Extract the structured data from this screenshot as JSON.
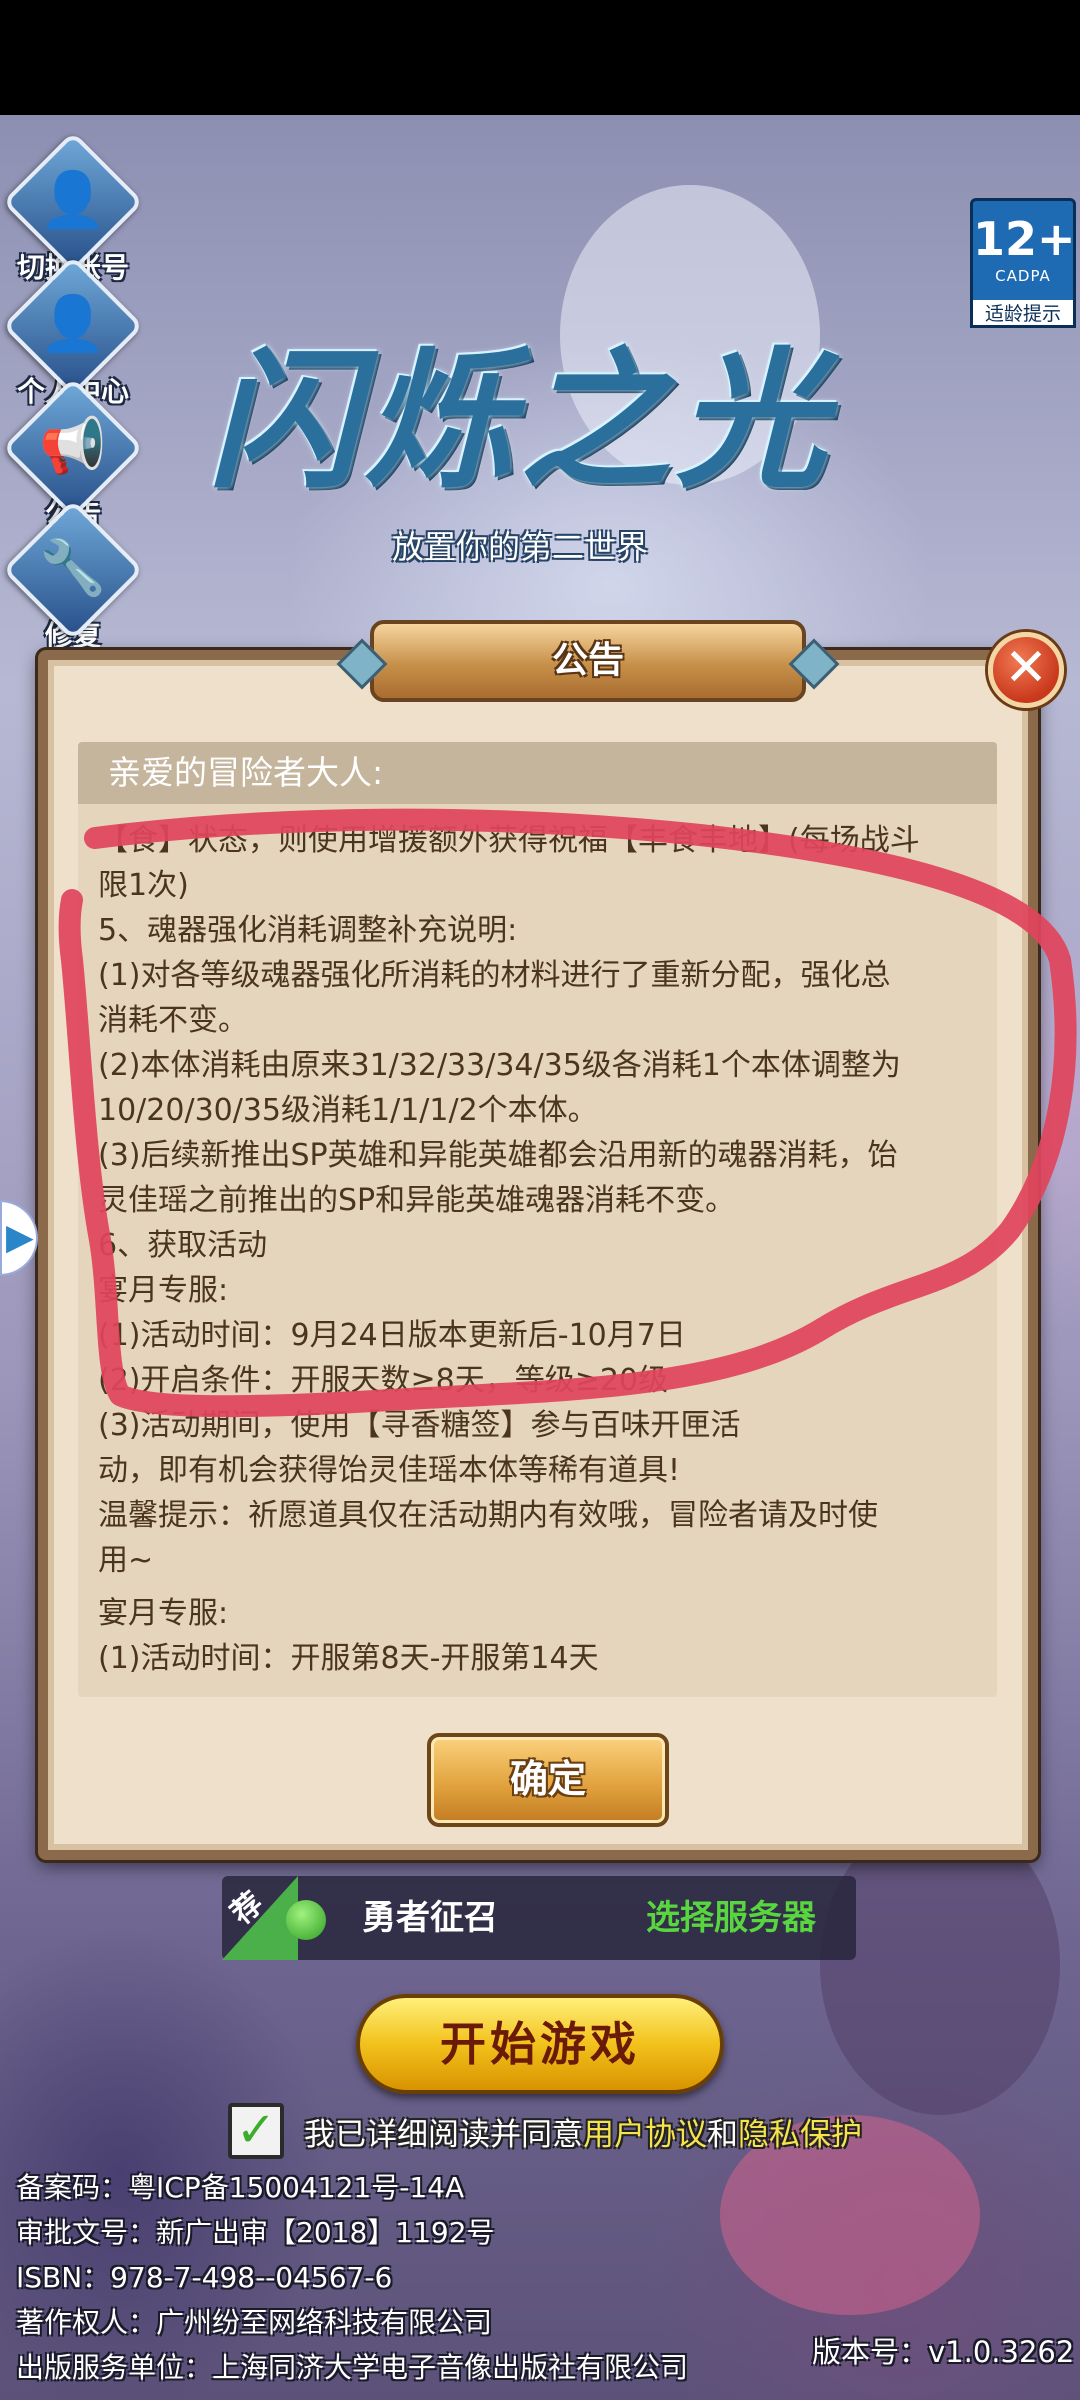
{
  "side_buttons": [
    {
      "label": "切换账号",
      "icon": "user-swap-icon"
    },
    {
      "label": "个人中心",
      "icon": "user-icon"
    },
    {
      "label": "公告",
      "icon": "megaphone-icon"
    },
    {
      "label": "修复",
      "icon": "wrench-icon"
    }
  ],
  "rating": {
    "age": "12+",
    "org": "CADPA",
    "tip": "适龄提示"
  },
  "logo": {
    "title": "闪烁之光",
    "subtitle": "放置你的第二世界"
  },
  "dialog": {
    "header": "公告",
    "greeting": "亲爱的冒险者大人:",
    "lines": [
      "【食】状态，则使用增援额外获得祝福【丰食丰地】(每场战斗",
      "限1次)",
      "5、魂器强化消耗调整补充说明:",
      "(1)对各等级魂器强化所消耗的材料进行了重新分配，强化总",
      "消耗不变。",
      "(2)本体消耗由原来31/32/33/34/35级各消耗1个本体调整为",
      "10/20/30/35级消耗1/1/1/2个本体。",
      "(3)后续新推出SP英雄和异能英雄都会沿用新的魂器消耗，饴",
      "灵佳瑶之前推出的SP和异能英雄魂器消耗不变。",
      "6、获取活动",
      "宴月专服:",
      "(1)活动时间：9月24日版本更新后-10月7日",
      "(2)开启条件：开服天数≥8天，等级≥20级",
      "(3)活动期间，使用【寻香糖签】参与百味开匣活",
      "动，即有机会获得饴灵佳瑶本体等稀有道具!",
      "温馨提示：祈愿道具仅在活动期内有效哦，冒险者请及时使",
      "用~",
      "宴月专服:",
      "(1)活动时间：开服第8天-开服第14天"
    ],
    "confirm": "确定",
    "close_icon": "close-icon"
  },
  "server": {
    "tag": "荐",
    "name": "勇者征召",
    "select": "选择服务器",
    "status_color": "#3aae2b"
  },
  "start_button": "开始游戏",
  "agreement": {
    "prefix": "我已详细阅读并同意",
    "user_agreement": "用户协议",
    "and": "和",
    "privacy": "隐私保护",
    "checked": true
  },
  "footer": {
    "icp": "备案码：粤ICP备15004121号-14A",
    "approval": "审批文号：新广出审【2018】1192号",
    "isbn": "ISBN：978-7-498--04567-6",
    "copyright": "著作权人：广州纷至网络科技有限公司",
    "publisher": "出版服务单位：上海同济大学电子音像出版社有限公司",
    "version": "版本号：v1.0.3262"
  },
  "annotation_color": "#e0455d"
}
